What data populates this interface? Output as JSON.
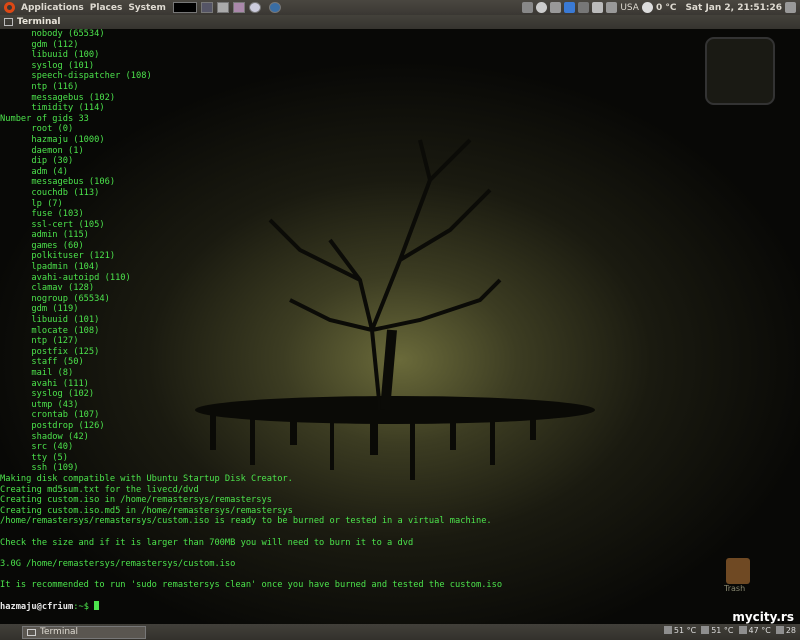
{
  "top_panel": {
    "menus": [
      "Applications",
      "Places",
      "System"
    ],
    "locale": "USA",
    "weather": "0 °C",
    "datetime": "Sat Jan 2, 21:51:26"
  },
  "window": {
    "title": "Terminal"
  },
  "terminal": {
    "lines": [
      "      nobody (65534)",
      "      gdm (112)",
      "      libuuid (100)",
      "      syslog (101)",
      "      speech-dispatcher (108)",
      "      ntp (116)",
      "      messagebus (102)",
      "      timidity (114)",
      "Number of gids 33",
      "      root (0)",
      "      hazmaju (1000)",
      "      daemon (1)",
      "      dip (30)",
      "      adm (4)",
      "      messagebus (106)",
      "      couchdb (113)",
      "      lp (7)",
      "      fuse (103)",
      "      ssl-cert (105)",
      "      admin (115)",
      "      games (60)",
      "      polkituser (121)",
      "      lpadmin (104)",
      "      avahi-autoipd (110)",
      "      clamav (128)",
      "      nogroup (65534)",
      "      gdm (119)",
      "      libuuid (101)",
      "      mlocate (108)",
      "      ntp (127)",
      "      postfix (125)",
      "      staff (50)",
      "      mail (8)",
      "      avahi (111)",
      "      syslog (102)",
      "      utmp (43)",
      "      crontab (107)",
      "      postdrop (126)",
      "      shadow (42)",
      "      src (40)",
      "      tty (5)",
      "      ssh (109)",
      "Making disk compatible with Ubuntu Startup Disk Creator.",
      "Creating md5sum.txt for the livecd/dvd",
      "Creating custom.iso in /home/remastersys/remastersys",
      "Creating custom.iso.md5 in /home/remastersys/remastersys",
      "/home/remastersys/remastersys/custom.iso is ready to be burned or tested in a virtual machine.",
      "",
      "Check the size and if it is larger than 700MB you will need to burn it to a dvd",
      "",
      "3.0G /home/remastersys/remastersys/custom.iso",
      "",
      "It is recommended to run 'sudo remastersys clean' once you have burned and tested the custom.iso",
      ""
    ],
    "prompt_user": "hazmaju@cfrium",
    "prompt_suffix": ":~$ "
  },
  "desktop": {
    "trash_label": "Trash"
  },
  "bottom_panel": {
    "taskbar_label": "Terminal",
    "temps": [
      "51 °C",
      "51 °C",
      "47 °C",
      "28"
    ]
  },
  "watermark": "mycity.rs"
}
